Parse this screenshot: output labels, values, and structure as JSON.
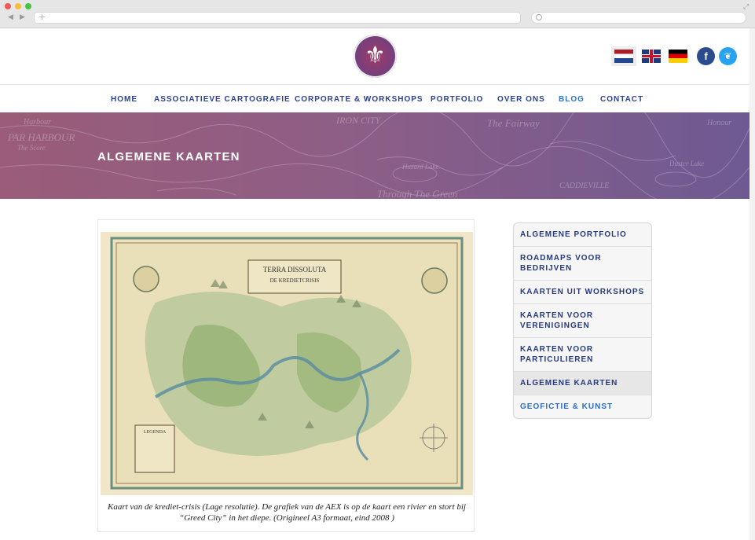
{
  "browser": {
    "back_icon": "◀",
    "forward_icon": "▶",
    "new_tab_icon": "+",
    "expand_icon": "⤢"
  },
  "header": {
    "logo_icon": "⚜",
    "languages": [
      {
        "name": "nl-flag-icon",
        "active": true
      },
      {
        "name": "uk-flag-icon",
        "active": false
      },
      {
        "name": "de-flag-icon",
        "active": false
      }
    ],
    "facebook_glyph": "f",
    "twitter_glyph": "❦"
  },
  "menu": {
    "items": [
      {
        "label": "HOME"
      },
      {
        "label": "ASSOCIATIEVE CARTOGRAFIE"
      },
      {
        "label": "CORPORATE & WORKSHOPS"
      },
      {
        "label": "PORTFOLIO"
      },
      {
        "label": "OVER ONS"
      },
      {
        "label": "BLOG"
      },
      {
        "label": "CONTACT"
      }
    ]
  },
  "banner": {
    "title": "ALGEMENE KAARTEN",
    "map_words": [
      "Harbour",
      "PAR HARBOUR",
      "The Score",
      "IRON CITY",
      "The Fairway",
      "Hazard Lake",
      "Through The Green",
      "CADDIEVILLE",
      "Honour",
      "Duster Lake"
    ]
  },
  "figure": {
    "map_title_1": "TERRA DISSOLUTA",
    "map_title_2": "DE KREDIETCRISIS",
    "legend_title": "LEGENDA",
    "caption_line1": "Kaart van de krediet-crisis (Lage resolutie). De grafiek van de AEX is op de kaart een rivier en stort bij",
    "caption_line2": "“Greed City” in het diepe. (Origineel A3 formaat, eind 2008 )"
  },
  "sidebar": {
    "items": [
      {
        "label": "ALGEMENE PORTFOLIO"
      },
      {
        "label": "ROADMAPS VOOR BEDRIJVEN"
      },
      {
        "label": "KAARTEN UIT WORKSHOPS"
      },
      {
        "label": "KAARTEN VOOR VERENIGINGEN"
      },
      {
        "label": "KAARTEN VOOR PARTICULIEREN"
      },
      {
        "label": "ALGEMENE KAARTEN"
      },
      {
        "label": "GEOFICTIE & KUNST"
      }
    ]
  },
  "colors": {
    "nav_text": "#2b3f8f",
    "nav_active": "#2e72c8",
    "banner_left": "#9a5c78",
    "banner_right": "#6e5a92"
  }
}
